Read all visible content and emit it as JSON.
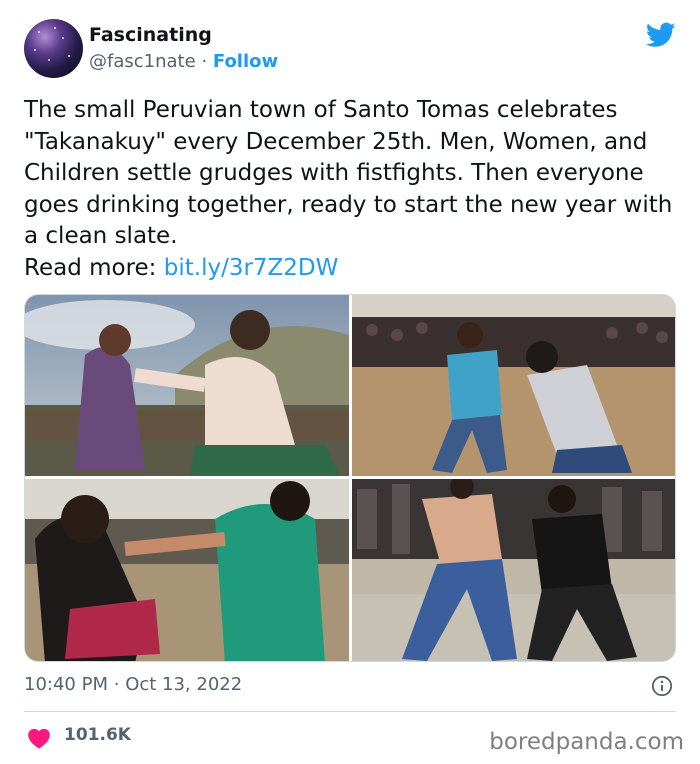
{
  "author": {
    "display_name": "Fascinating",
    "handle": "@fasc1nate",
    "separator": "·",
    "follow_label": "Follow"
  },
  "icons": {
    "platform": "twitter-bird-icon",
    "info": "info-icon",
    "like": "heart-icon"
  },
  "tweet": {
    "text": "The small Peruvian town of Santo Tomas celebrates \"Takanakuy\" every December 25th. Men, Women, and Children settle grudges with fistfights. Then everyone goes drinking together, ready to start the new year with a clean slate.\nRead more: ",
    "link": "bit.ly/3r7Z2DW"
  },
  "media": {
    "count": 4,
    "photos": [
      "Two women fighting outdoors in front of crowd",
      "Two men fighting in dirt arena",
      "Two women exchanging punches",
      "Shirtless man fighting man in black"
    ]
  },
  "timestamp": {
    "time": "10:40 PM",
    "separator": "·",
    "date": "Oct 13, 2022"
  },
  "engagement": {
    "likes": "101.6K"
  },
  "watermark": "boredpanda.com",
  "colors": {
    "accent": "#1d9bf0",
    "like": "#f91880",
    "text": "#0f1419",
    "secondary": "#536471"
  }
}
